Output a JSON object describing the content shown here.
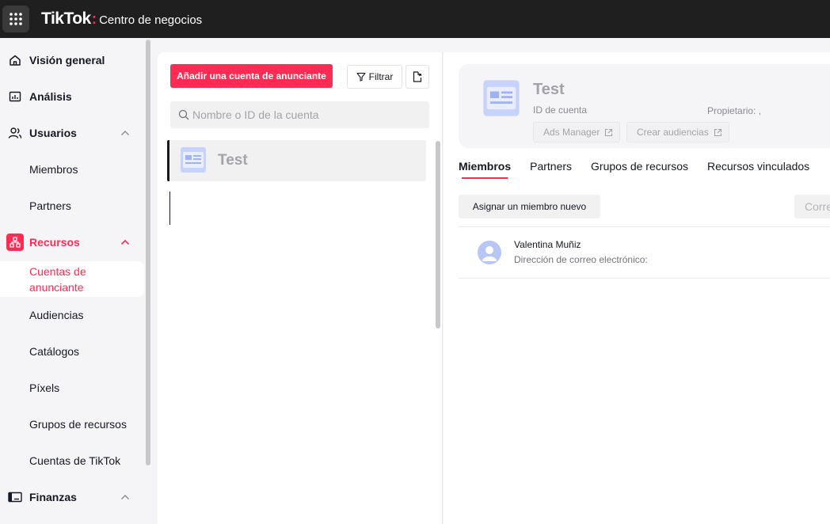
{
  "header": {
    "brand": "TikTok",
    "colon": ":",
    "subtitle": "Centro de negocios",
    "apps_icon": "grid-icon"
  },
  "sidebar": {
    "items": [
      {
        "label": "Visión general",
        "icon": "home-icon"
      },
      {
        "label": "Análisis",
        "icon": "chart-icon"
      },
      {
        "label": "Usuarios",
        "icon": "users-icon",
        "expanded": true
      },
      {
        "label": "Miembros"
      },
      {
        "label": "Partners"
      },
      {
        "label": "Recursos",
        "icon": "resources-icon",
        "expanded": true
      },
      {
        "label": "Cuentas de anunciante",
        "selected": true
      },
      {
        "label": "Audiencias"
      },
      {
        "label": "Catálogos"
      },
      {
        "label": "Píxels"
      },
      {
        "label": "Grupos de recursos"
      },
      {
        "label": "Cuentas de TikTok"
      },
      {
        "label": "Finanzas",
        "icon": "finance-icon",
        "expanded": true
      }
    ]
  },
  "list": {
    "add_button": "Añadir una cuenta de anunciante",
    "filter_button": "Filtrar",
    "search_placeholder": "Nombre o ID de la cuenta",
    "accounts": [
      {
        "name": "Test"
      }
    ]
  },
  "detail": {
    "title": "Test",
    "id_label": "ID de cuenta",
    "owner_label": "Propietario: ,",
    "links": [
      "Ads Manager",
      "Crear audiencias"
    ],
    "tabs": [
      "Miembros",
      "Partners",
      "Grupos de recursos",
      "Recursos vinculados"
    ],
    "active_tab": "Miembros",
    "assign_button": "Asignar un miembro nuevo",
    "right_button": "Corre",
    "members": [
      {
        "name": "Valentina Muñiz",
        "email_label": "Dirección de correo electrónico:"
      }
    ]
  },
  "colors": {
    "accent": "#fe2c55",
    "topbar": "#1f1f1f",
    "avatar": "#b7c6f5"
  }
}
